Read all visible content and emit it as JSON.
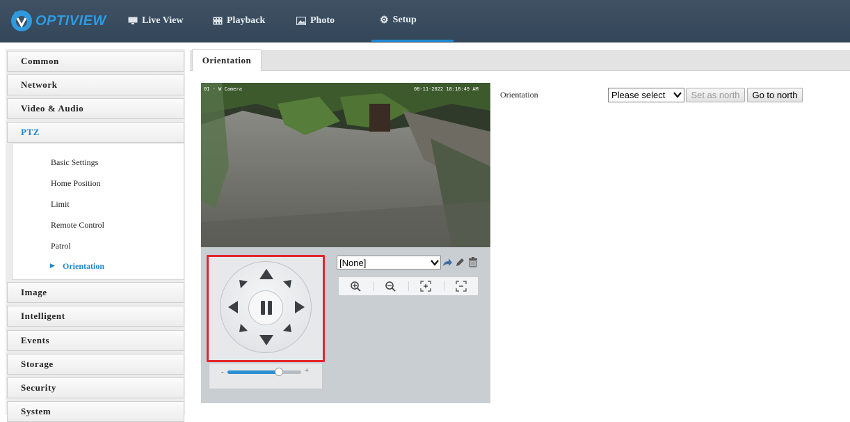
{
  "header": {
    "brand": "OPTIVIEW",
    "tabs": [
      {
        "label": "Live View",
        "icon": "monitor-icon"
      },
      {
        "label": "Playback",
        "icon": "film-icon"
      },
      {
        "label": "Photo",
        "icon": "image-icon"
      },
      {
        "label": "Setup",
        "icon": "gear-icon",
        "active": true
      }
    ]
  },
  "sidebar": {
    "items": [
      {
        "label": "Common"
      },
      {
        "label": "Network"
      },
      {
        "label": "Video & Audio"
      },
      {
        "label": "PTZ",
        "active": true
      },
      {
        "label": "Image"
      },
      {
        "label": "Intelligent"
      },
      {
        "label": "Events"
      },
      {
        "label": "Storage"
      },
      {
        "label": "Security"
      },
      {
        "label": "System"
      }
    ],
    "ptz_sub": [
      {
        "label": "Basic Settings"
      },
      {
        "label": "Home Position"
      },
      {
        "label": "Limit"
      },
      {
        "label": "Remote Control"
      },
      {
        "label": "Patrol"
      },
      {
        "label": "Orientation",
        "active": true
      }
    ]
  },
  "content": {
    "tab": "Orientation",
    "video": {
      "osd_left": "01 - W Camera",
      "osd_right": "08-11-2022 18:18:49 AM"
    },
    "ptz": {
      "preset_value": "[None]",
      "speed_min": "-",
      "speed_max": "+",
      "speed_level": 0.7
    },
    "form": {
      "label": "Orientation",
      "select_value": "Please select",
      "set_north": "Set as north",
      "goto_north": "Go to north"
    }
  },
  "colors": {
    "header_bg": "#3b4d5f",
    "accent": "#1f86cc",
    "highlight_box": "#e2262e"
  }
}
